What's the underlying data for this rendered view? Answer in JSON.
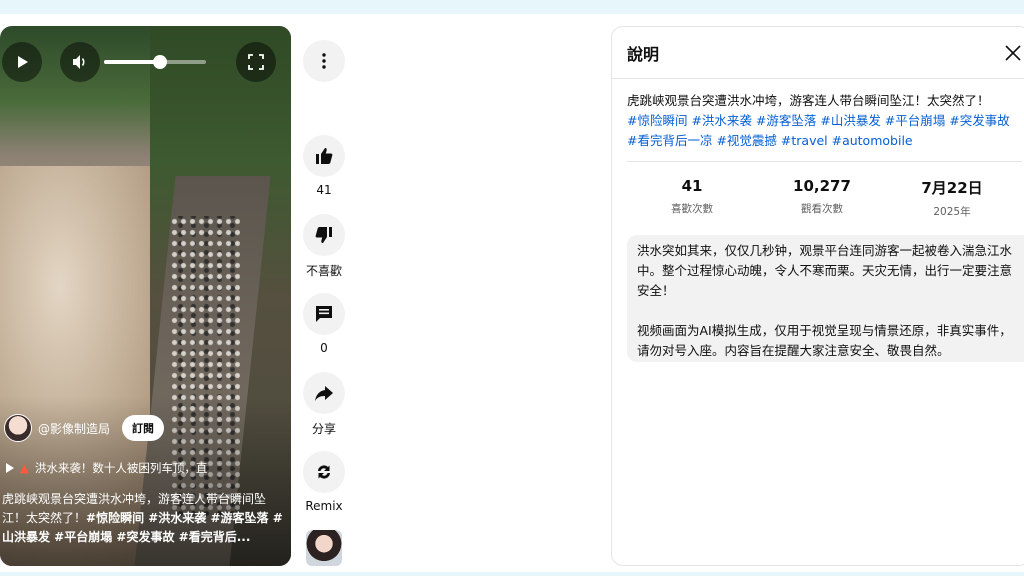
{
  "video": {
    "channel_name": "@影像制造局",
    "subscribe_label": "訂閱",
    "music_text": "洪水来袭！数十人被困列车顶，直",
    "description_plain": "虎跳峡观景台突遭洪水冲垮，游客连人带台瞬间坠江！太突然了！",
    "description_tags": "#惊险瞬间 #洪水来袭 #游客坠落 #山洪暴发 #平台崩塌 #突发事故 #看完背后...",
    "volume_level": 0.55
  },
  "actions": {
    "like_count": "41",
    "dislike_label": "不喜歡",
    "comment_count": "0",
    "share_label": "分享",
    "remix_label": "Remix"
  },
  "panel": {
    "title": "說明",
    "desc_text": "虎跳峡观景台突遭洪水冲垮，游客连人带台瞬间坠江！太突然了！",
    "tags_line1": "#惊险瞬间 #洪水来袭 #游客坠落 #山洪暴发 #平台崩塌 #突发事故",
    "tags_line2": "#看完背后一凉 #视觉震撼 #travel #automobile",
    "stats": [
      {
        "value": "41",
        "label": "喜歡次數"
      },
      {
        "value": "10,277",
        "label": "觀看次數"
      },
      {
        "value": "7月22日",
        "label": "2025年"
      }
    ],
    "body_p1": "洪水突如其来，仅仅几秒钟，观景平台连同游客一起被卷入湍急江水中。整个过程惊心动魄，令人不寒而栗。天灾无情，出行一定要注意安全！",
    "body_p2": "视频画面为AI模拟生成，仅用于视觉呈现与情景还原，非真实事件，请勿对号入座。内容旨在提醒大家注意安全、敬畏自然。"
  },
  "colors": {
    "link": "#065fd4",
    "button_bg": "#f2f2f2",
    "top_strip": "#e6f6fb"
  }
}
